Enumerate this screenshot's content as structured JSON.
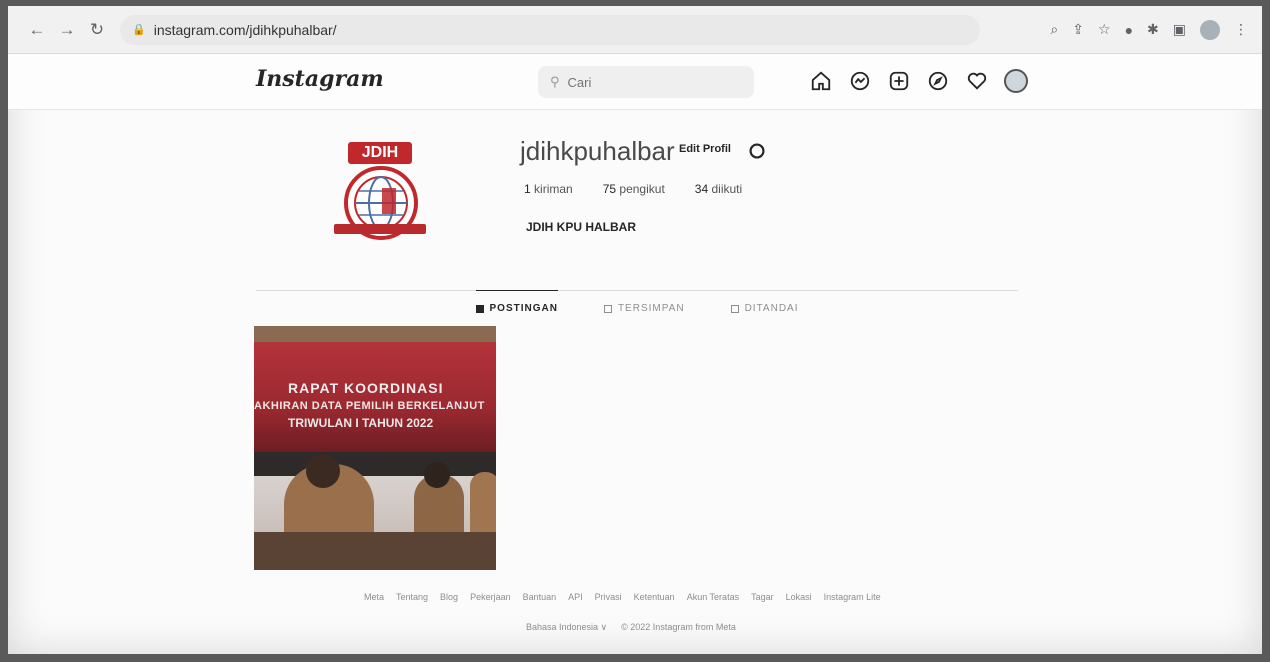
{
  "browser": {
    "url": "instagram.com/jdihkpuhalbar/"
  },
  "ig": {
    "logo": "Instagram",
    "search_placeholder": "Cari"
  },
  "profile": {
    "logo_text": "JDIH",
    "username": "jdihkpuhalbar",
    "edit_label": "Edit Profil",
    "stats": [
      {
        "value": "1",
        "label": "kiriman"
      },
      {
        "value": "75",
        "label": "pengikut"
      },
      {
        "value": "34",
        "label": "diikuti"
      }
    ],
    "full_name": "JDIH KPU HALBAR"
  },
  "tabs": [
    {
      "label": "POSTINGAN",
      "active": true
    },
    {
      "label": "TERSIMPAN",
      "active": false
    },
    {
      "label": "DITANDAI",
      "active": false
    }
  ],
  "post": {
    "title": "RAPAT KOORDINASI",
    "subtitle": "AKHIRAN DATA PEMILIH BERKELANJUT",
    "subtitle2": "TRIWULAN I TAHUN 2022"
  },
  "footer": {
    "links": [
      "Meta",
      "Tentang",
      "Blog",
      "Pekerjaan",
      "Bantuan",
      "API",
      "Privasi",
      "Ketentuan",
      "Akun Teratas",
      "Tagar",
      "Lokasi",
      "Instagram Lite"
    ],
    "language": "Bahasa Indonesia ∨",
    "copyright": "© 2022 Instagram from Meta"
  },
  "colors": {
    "brand_red": "#c0282c",
    "text": "#262626",
    "muted": "#8e8e8e"
  }
}
